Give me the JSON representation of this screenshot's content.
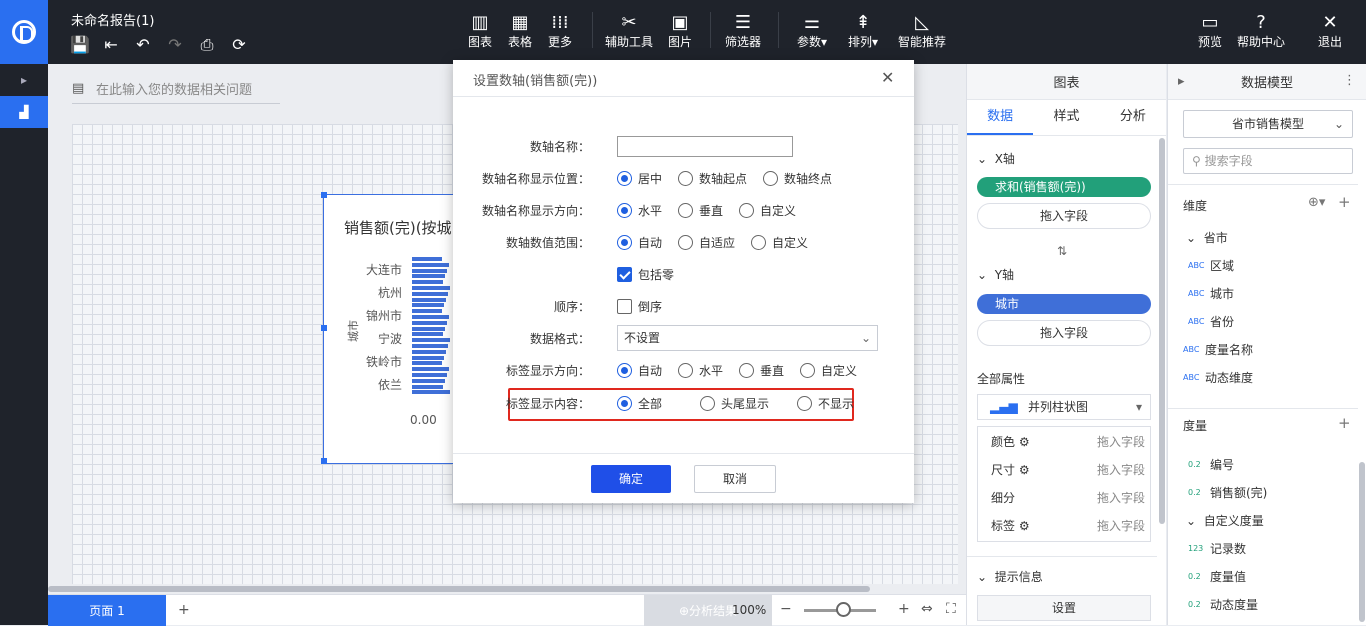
{
  "app": {
    "report_title": "未命名报告(1)"
  },
  "toolbar": {
    "chart": "图表",
    "table": "表格",
    "more": "更多",
    "aux_tools": "辅助工具",
    "image": "图片",
    "filter": "筛选器",
    "params": "参数",
    "sort": "排列",
    "smart": "智能推荐",
    "preview": "预览",
    "help": "帮助中心",
    "exit": "退出"
  },
  "query": {
    "placeholder": "在此输入您的数据相关问题"
  },
  "chart": {
    "title": "销售额(完)(按城",
    "ylabel": "城市",
    "x_tick": "0.00"
  },
  "chart_data": {
    "type": "bar",
    "title": "销售额(完)(按城",
    "ylabel": "城市",
    "categories": [
      "大连市",
      "杭州",
      "锦州市",
      "宁波",
      "铁岭市",
      "依兰"
    ],
    "x_ticks": [
      "0.00"
    ]
  },
  "bottom": {
    "page": "页面 1",
    "add": "+",
    "analysis": "分析结果",
    "zoom": "100%"
  },
  "panel_chart": {
    "header": "图表",
    "tabs": [
      "数据",
      "样式",
      "分析"
    ],
    "x_axis": "X轴",
    "x_field": "求和(销售额(完))",
    "drag": "拖入字段",
    "y_axis": "Y轴",
    "y_field": "城市",
    "all_props": "全部属性",
    "chart_type": "并列柱状图",
    "props": [
      {
        "label": "颜色",
        "value": "拖入字段"
      },
      {
        "label": "尺寸",
        "value": "拖入字段"
      },
      {
        "label": "细分",
        "value": "拖入字段"
      },
      {
        "label": "标签",
        "value": "拖入字段"
      }
    ],
    "tooltip": "提示信息",
    "settings": "设置"
  },
  "panel_model": {
    "header": "数据模型",
    "model": "省市销售模型",
    "search_placeholder": "搜索字段",
    "dimension": "维度",
    "dim_group": "省市",
    "dims": [
      {
        "type": "ABC",
        "name": "区域"
      },
      {
        "type": "ABC",
        "name": "城市"
      },
      {
        "type": "ABC",
        "name": "省份"
      }
    ],
    "dims2": [
      {
        "type": "ABC",
        "name": "度量名称"
      },
      {
        "type": "ABC",
        "name": "动态维度"
      }
    ],
    "measure": "度量",
    "measures": [
      {
        "type": "0.2",
        "name": "编号"
      },
      {
        "type": "0.2",
        "name": "销售额(完)"
      }
    ],
    "custom_group": "自定义度量",
    "custom": [
      {
        "type": "123",
        "name": "记录数"
      },
      {
        "type": "0.2",
        "name": "度量值"
      },
      {
        "type": "0.2",
        "name": "动态度量"
      }
    ]
  },
  "dialog": {
    "title": "设置数轴(销售额(完))",
    "name_label": "数轴名称：",
    "name_value": "",
    "pos_label": "数轴名称显示位置：",
    "pos_opts": [
      "居中",
      "数轴起点",
      "数轴终点"
    ],
    "dir_label": "数轴名称显示方向：",
    "dir_opts": [
      "水平",
      "垂直",
      "自定义"
    ],
    "range_label": "数轴数值范围：",
    "range_opts": [
      "自动",
      "自适应",
      "自定义"
    ],
    "include_zero": "包括零",
    "order_label": "顺序：",
    "reverse": "倒序",
    "format_label": "数据格式：",
    "format_value": "不设置",
    "labeldir_label": "标签显示方向：",
    "labeldir_opts": [
      "自动",
      "水平",
      "垂直",
      "自定义"
    ],
    "content_label": "标签显示内容：",
    "content_opts": [
      "全部",
      "头尾显示",
      "不显示"
    ],
    "ok": "确定",
    "cancel": "取消"
  }
}
